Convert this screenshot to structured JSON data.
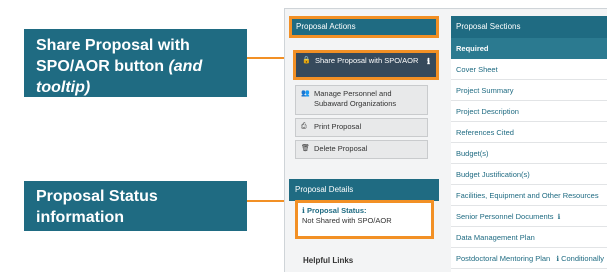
{
  "callouts": {
    "share_main": "Share Proposal with SPO/AOR button",
    "share_em": "(and tooltip)",
    "status": "Proposal Status information"
  },
  "actions_panel": {
    "title": "Proposal Actions",
    "share_button": {
      "label": "Share Proposal with SPO/AOR",
      "icon": "lock-icon",
      "info_icon": "info-icon"
    },
    "manage_button": {
      "label": "Manage Personnel and Subaward Organizations",
      "icon": "users-icon"
    },
    "print_button": {
      "label": "Print Proposal",
      "icon": "print-icon"
    },
    "delete_button": {
      "label": "Delete Proposal",
      "icon": "trash-icon"
    }
  },
  "details_panel": {
    "title": "Proposal Details",
    "status_label": "Proposal Status:",
    "status_value": "Not Shared with SPO/AOR",
    "helpful_links": "Helpful Links"
  },
  "sections_panel": {
    "title": "Proposal Sections",
    "required_label": "Required",
    "items": [
      {
        "label": "Cover Sheet"
      },
      {
        "label": "Project Summary"
      },
      {
        "label": "Project Description"
      },
      {
        "label": "References Cited"
      },
      {
        "label": "Budget(s)"
      },
      {
        "label": "Budget Justification(s)"
      },
      {
        "label": "Facilities, Equipment and Other Resources"
      },
      {
        "label": "Senior Personnel Documents"
      },
      {
        "label": "Data Management Plan"
      },
      {
        "label": "Postdoctoral Mentoring Plan"
      }
    ],
    "conditionally_label": "Conditionally"
  },
  "colors": {
    "accent": "#1f6b82",
    "highlight": "#f29025",
    "dark_button": "#364a5c"
  }
}
